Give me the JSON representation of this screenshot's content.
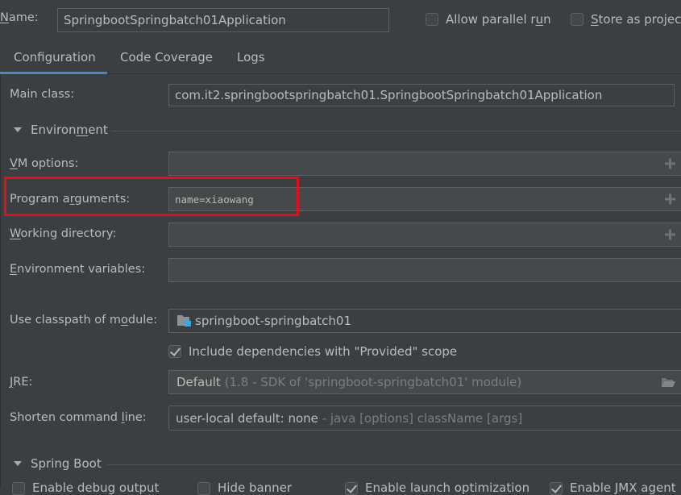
{
  "header": {
    "name_label_pre": "",
    "name_label_mnemonic": "N",
    "name_label_post": "ame:",
    "name_value": "SpringbootSpringbatch01Application",
    "allow_parallel_run": {
      "label_pre": "Allow parallel r",
      "label_mnemonic": "u",
      "label_post": "n",
      "checked": false
    },
    "store_as_project": {
      "label_pre": "",
      "label_mnemonic": "S",
      "label_post": "tore as project file",
      "checked": false
    }
  },
  "tabs": [
    {
      "label": "Configuration",
      "active": true
    },
    {
      "label": "Code Coverage",
      "active": false
    },
    {
      "label": "Logs",
      "active": false
    }
  ],
  "accent_color": "#4a88c7",
  "highlight_color": "#e0101c",
  "configuration": {
    "main_class": {
      "label": "Main class:",
      "value": "com.it2.springbootspringbatch01.SpringbootSpringbatch01Application"
    },
    "environment_section": {
      "label_pre": "Environ",
      "label_mnemonic": "m",
      "label_post": "ent",
      "expanded": true
    },
    "vm_options": {
      "label_pre": "",
      "label_mnemonic": "V",
      "label_post": "M options:",
      "value": ""
    },
    "program_arguments": {
      "label_pre": "Program a",
      "label_mnemonic": "r",
      "label_post": "guments:",
      "value": "name=xiaowang"
    },
    "working_directory": {
      "label_pre": "",
      "label_mnemonic": "W",
      "label_post": "orking directory:",
      "value": ""
    },
    "environment_variables": {
      "label_pre": "",
      "label_mnemonic": "E",
      "label_post": "nvironment variables:",
      "value": ""
    },
    "classpath_module": {
      "label_pre": "Use classpath of m",
      "label_mnemonic": "o",
      "label_post": "dule:",
      "value": "springboot-springbatch01",
      "icon": "module-folder-icon"
    },
    "include_provided": {
      "label": "Include dependencies with \"Provided\" scope",
      "checked": true
    },
    "jre": {
      "label_pre": "",
      "label_mnemonic": "J",
      "label_post": "RE:",
      "value": "Default",
      "hint": "(1.8 - SDK of 'springboot-springbatch01' module)"
    },
    "shorten_command_line": {
      "label_pre": "Shorten command ",
      "label_mnemonic": "l",
      "label_post": "ine:",
      "value": "user-local default: none",
      "hint": "- java [options] className [args]"
    }
  },
  "spring_boot": {
    "section_label": "Spring Boot",
    "expanded": true,
    "options": [
      {
        "label": "Enable debug output",
        "checked": false
      },
      {
        "label": "Hide banner",
        "checked": false
      },
      {
        "label": "Enable launch optimization",
        "checked": true
      },
      {
        "label": "Enable JMX agent",
        "checked": true
      }
    ]
  }
}
